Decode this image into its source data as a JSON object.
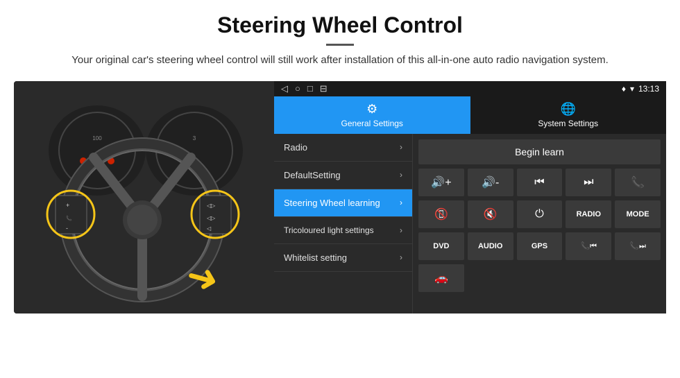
{
  "header": {
    "title": "Steering Wheel Control",
    "subtitle": "Your original car's steering wheel control will still work after installation of this all-in-one auto radio navigation system."
  },
  "status_bar": {
    "icons": [
      "◁",
      "○",
      "□",
      "⊟"
    ],
    "time": "13:13",
    "signal_icons": [
      "♦",
      "▾"
    ]
  },
  "tabs": [
    {
      "id": "general",
      "label": "General Settings",
      "active": true
    },
    {
      "id": "system",
      "label": "System Settings",
      "active": false
    }
  ],
  "menu_items": [
    {
      "id": "radio",
      "label": "Radio",
      "active": false
    },
    {
      "id": "default",
      "label": "DefaultSetting",
      "active": false
    },
    {
      "id": "steering",
      "label": "Steering Wheel learning",
      "active": true
    },
    {
      "id": "tricolour",
      "label": "Tricoloured light settings",
      "active": false
    },
    {
      "id": "whitelist",
      "label": "Whitelist setting",
      "active": false
    }
  ],
  "begin_learn_label": "Begin learn",
  "control_buttons_row1": [
    {
      "id": "vol-up",
      "label": "🔊+",
      "unicode": "🔊+"
    },
    {
      "id": "vol-down",
      "label": "🔊-",
      "unicode": "🔊-"
    },
    {
      "id": "prev-track",
      "label": "⏮",
      "unicode": "⏮"
    },
    {
      "id": "next-track",
      "label": "⏭",
      "unicode": "⏭"
    },
    {
      "id": "phone",
      "label": "📞",
      "unicode": "📞"
    }
  ],
  "control_buttons_row2": [
    {
      "id": "hang-up",
      "label": "📵",
      "unicode": "📵"
    },
    {
      "id": "mute",
      "label": "🔇",
      "unicode": "🔇"
    },
    {
      "id": "power",
      "label": "⏻",
      "unicode": "⏻"
    },
    {
      "id": "radio-btn",
      "label": "RADIO",
      "unicode": "RADIO"
    },
    {
      "id": "mode-btn",
      "label": "MODE",
      "unicode": "MODE"
    }
  ],
  "control_buttons_row3": [
    {
      "id": "dvd-btn",
      "label": "DVD",
      "unicode": "DVD"
    },
    {
      "id": "audio-btn",
      "label": "AUDIO",
      "unicode": "AUDIO"
    },
    {
      "id": "gps-btn",
      "label": "GPS",
      "unicode": "GPS"
    },
    {
      "id": "tel-prev",
      "label": "📞⏮",
      "unicode": "📞⏮"
    },
    {
      "id": "tel-next",
      "label": "📞⏭",
      "unicode": "📞⏭"
    }
  ],
  "last_row": [
    {
      "id": "car-icon",
      "label": "🚗",
      "unicode": "🚗"
    }
  ]
}
